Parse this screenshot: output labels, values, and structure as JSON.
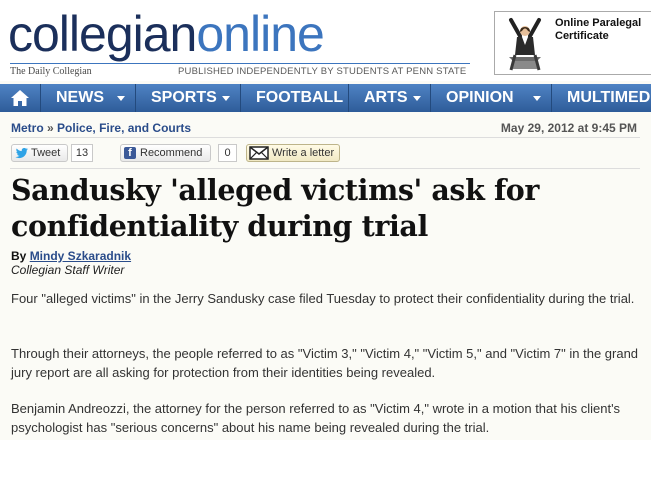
{
  "masthead": {
    "logo_part1": "collegian",
    "logo_part2": "online",
    "daily": "The Daily Collegian",
    "tagline": "PUBLISHED INDEPENDENTLY BY STUDENTS AT PENN STATE"
  },
  "ad": {
    "line1": "Online Paralegal",
    "line2": "Certificate"
  },
  "nav": {
    "home_icon": "home-icon",
    "items": [
      {
        "label": "NEWS"
      },
      {
        "label": "SPORTS"
      },
      {
        "label": "FOOTBALL"
      },
      {
        "label": "ARTS"
      },
      {
        "label": "OPINION"
      },
      {
        "label": "MULTIMED"
      }
    ]
  },
  "breadcrumb": {
    "section": "Metro",
    "separator": "»",
    "subsection": "Police, Fire, and Courts"
  },
  "date": "May 29, 2012 at 9:45 PM",
  "share": {
    "tweet_label": "Tweet",
    "tweet_count": "13",
    "recommend_label": "Recommend",
    "recommend_count": "0",
    "letter_label": "Write a letter"
  },
  "article": {
    "headline": "Sandusky 'alleged victims' ask for confidentiality during trial",
    "by": "By",
    "author": "Mindy Szkaradnik",
    "role": "Collegian Staff Writer",
    "paragraphs": [
      "Four \"alleged victims\" in the Jerry Sandusky case filed Tuesday to protect their confidentiality during the trial.",
      "Through their attorneys, the people referred to as \"Victim 3,\" \"Victim 4,\" \"Victim 5,\" and \"Victim 7\" in the grand jury report are all asking for protection from their identities being revealed.",
      "Benjamin Andreozzi, the attorney for the person referred to as \"Victim 4,\" wrote in a motion that his client's psychologist has \"serious concerns\" about his name being revealed during the trial."
    ]
  },
  "colors": {
    "nav_top": "#4f83c4",
    "nav_bottom": "#2e5c99",
    "logo_dark": "#1b2f5b",
    "logo_light": "#3c75be",
    "link": "#2a4c8a",
    "facebook": "#3b5998",
    "twitter": "#2fa3e6"
  }
}
